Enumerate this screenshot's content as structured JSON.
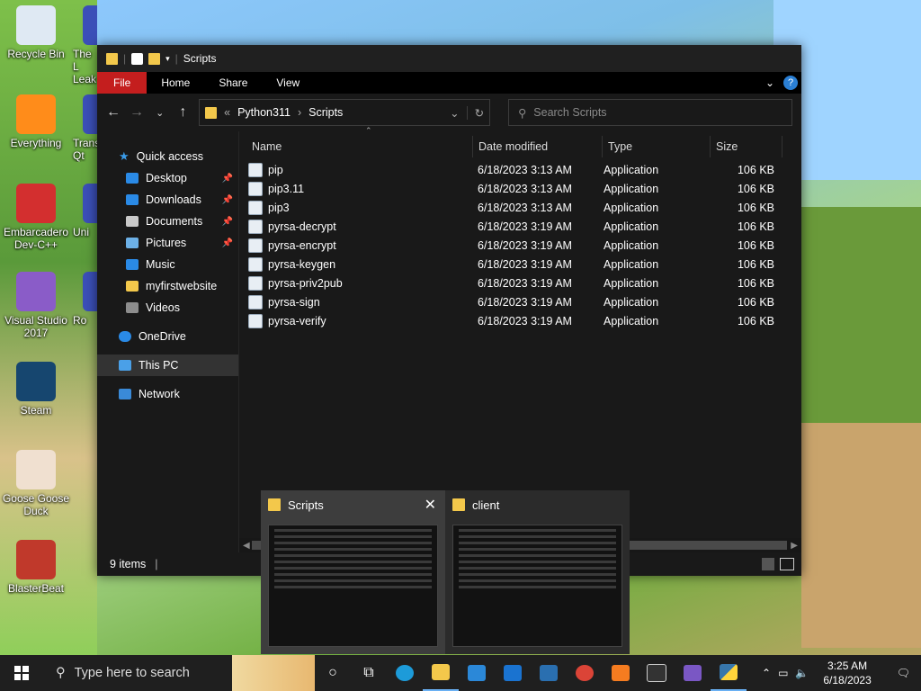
{
  "desktop": {
    "icons": [
      {
        "label": "Recycle Bin",
        "color": "#dfe9f3"
      },
      {
        "label": "Everything",
        "color": "#ff8c1a"
      },
      {
        "label": "Embarcadero Dev-C++",
        "color": "#d32f2f"
      },
      {
        "label": "Visual Studio 2017",
        "color": "#8a5cc8"
      },
      {
        "label": "Steam",
        "color": "#16466f"
      },
      {
        "label": "Goose Goose Duck",
        "color": "#f0e0d0"
      },
      {
        "label": "BlasterBeat",
        "color": "#c0392b"
      }
    ],
    "partial_icons": [
      {
        "label": "The L Leak"
      },
      {
        "label": "Trans Qt"
      },
      {
        "label": "Uni"
      },
      {
        "label": "Ro"
      }
    ]
  },
  "window": {
    "title": "Scripts",
    "ribbon": {
      "file": "File",
      "home": "Home",
      "share": "Share",
      "view": "View"
    },
    "address": {
      "prefix": "«",
      "seg1": "Python311",
      "sep": "›",
      "seg2": "Scripts"
    },
    "search": {
      "placeholder": "Search Scripts"
    },
    "nav": {
      "quick_access": "Quick access",
      "items": [
        {
          "label": "Desktop",
          "color": "#2a8ae6",
          "pinned": true
        },
        {
          "label": "Downloads",
          "color": "#2a8ae6",
          "pinned": true
        },
        {
          "label": "Documents",
          "color": "#c9c9c9",
          "pinned": true
        },
        {
          "label": "Pictures",
          "color": "#6cb0e6",
          "pinned": true
        },
        {
          "label": "Music",
          "color": "#2a8ae6",
          "pinned": false
        },
        {
          "label": "myfirstwebsite",
          "color": "#f3c84b",
          "pinned": false
        },
        {
          "label": "Videos",
          "color": "#8d8d8d",
          "pinned": false
        }
      ],
      "onedrive": "OneDrive",
      "this_pc": "This PC",
      "network": "Network"
    },
    "columns": {
      "name": "Name",
      "date": "Date modified",
      "type": "Type",
      "size": "Size"
    },
    "files": [
      {
        "name": "pip",
        "date": "6/18/2023 3:13 AM",
        "type": "Application",
        "size": "106 KB"
      },
      {
        "name": "pip3.11",
        "date": "6/18/2023 3:13 AM",
        "type": "Application",
        "size": "106 KB"
      },
      {
        "name": "pip3",
        "date": "6/18/2023 3:13 AM",
        "type": "Application",
        "size": "106 KB"
      },
      {
        "name": "pyrsa-decrypt",
        "date": "6/18/2023 3:19 AM",
        "type": "Application",
        "size": "106 KB"
      },
      {
        "name": "pyrsa-encrypt",
        "date": "6/18/2023 3:19 AM",
        "type": "Application",
        "size": "106 KB"
      },
      {
        "name": "pyrsa-keygen",
        "date": "6/18/2023 3:19 AM",
        "type": "Application",
        "size": "106 KB"
      },
      {
        "name": "pyrsa-priv2pub",
        "date": "6/18/2023 3:19 AM",
        "type": "Application",
        "size": "106 KB"
      },
      {
        "name": "pyrsa-sign",
        "date": "6/18/2023 3:19 AM",
        "type": "Application",
        "size": "106 KB"
      },
      {
        "name": "pyrsa-verify",
        "date": "6/18/2023 3:19 AM",
        "type": "Application",
        "size": "106 KB"
      }
    ],
    "status": "9 items"
  },
  "thumbnails": [
    {
      "title": "Scripts",
      "active": true
    },
    {
      "title": "client",
      "active": false
    }
  ],
  "taskbar": {
    "search_placeholder": "Type here to search",
    "time": "3:25 AM",
    "date": "6/18/2023"
  }
}
